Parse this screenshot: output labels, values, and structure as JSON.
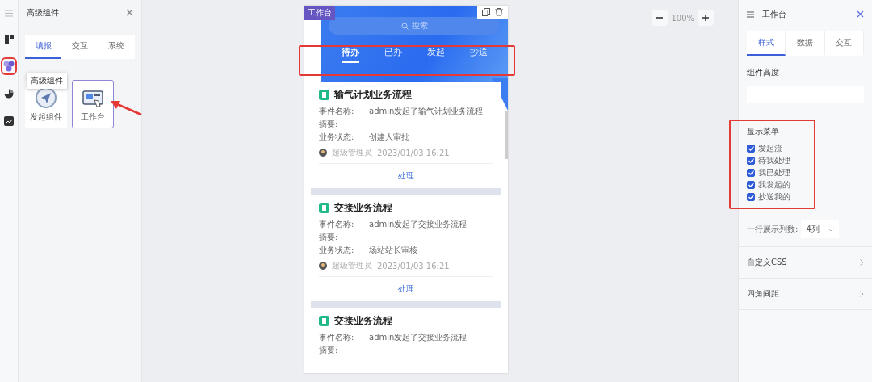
{
  "left_panel": {
    "title": "高级组件",
    "tabs": [
      {
        "label": "填报",
        "selected": true
      },
      {
        "label": "交互",
        "selected": false
      },
      {
        "label": "系统",
        "selected": false
      }
    ],
    "tooltip": "高级组件",
    "components": [
      {
        "label": "发起组件",
        "selected": false
      },
      {
        "label": "工作台",
        "selected": true
      }
    ]
  },
  "canvas": {
    "zoom": "100%",
    "widget_tag": "工作台",
    "search_placeholder": "搜索",
    "tabs": [
      {
        "label": "待办",
        "selected": true
      },
      {
        "label": "已办",
        "selected": false
      },
      {
        "label": "发起",
        "selected": false
      },
      {
        "label": "抄送",
        "selected": false
      }
    ],
    "cards": [
      {
        "title": "输气计划业务流程",
        "fields": [
          {
            "label": "事件名称:",
            "value": "admin发起了输气计划业务流程"
          },
          {
            "label": "摘要:"
          },
          {
            "label": "业务状态:",
            "value": "创建人审批"
          }
        ],
        "user": "超级管理员",
        "time": "2023/01/03 16:21",
        "action": "处理"
      },
      {
        "title": "交接业务流程",
        "fields": [
          {
            "label": "事件名称:",
            "value": "admin发起了交接业务流程"
          },
          {
            "label": "摘要:"
          },
          {
            "label": "业务状态:",
            "value": "场站站长审核"
          }
        ],
        "user": "超级管理员",
        "time": "2023/01/03 16:21",
        "action": "处理"
      },
      {
        "title": "交接业务流程",
        "fields": [
          {
            "label": "事件名称:",
            "value": "admin发起了交接业务流程"
          },
          {
            "label": "摘要:"
          }
        ]
      }
    ]
  },
  "right_panel": {
    "title": "工作台",
    "tabs": [
      {
        "label": "样式",
        "selected": true
      },
      {
        "label": "数据",
        "selected": false
      },
      {
        "label": "交互",
        "selected": false
      }
    ],
    "height_label": "组件高度",
    "menu_label": "显示菜单",
    "menu_items": [
      {
        "label": "发起流",
        "checked": true
      },
      {
        "label": "待我处理",
        "checked": true
      },
      {
        "label": "我已处理",
        "checked": true
      },
      {
        "label": "我发起的",
        "checked": true
      },
      {
        "label": "抄送我的",
        "checked": true
      }
    ],
    "columns_label": "一行展示列数:",
    "columns_value": "4列",
    "sections": [
      {
        "label": "自定义CSS"
      },
      {
        "label": "四角间距"
      }
    ]
  }
}
